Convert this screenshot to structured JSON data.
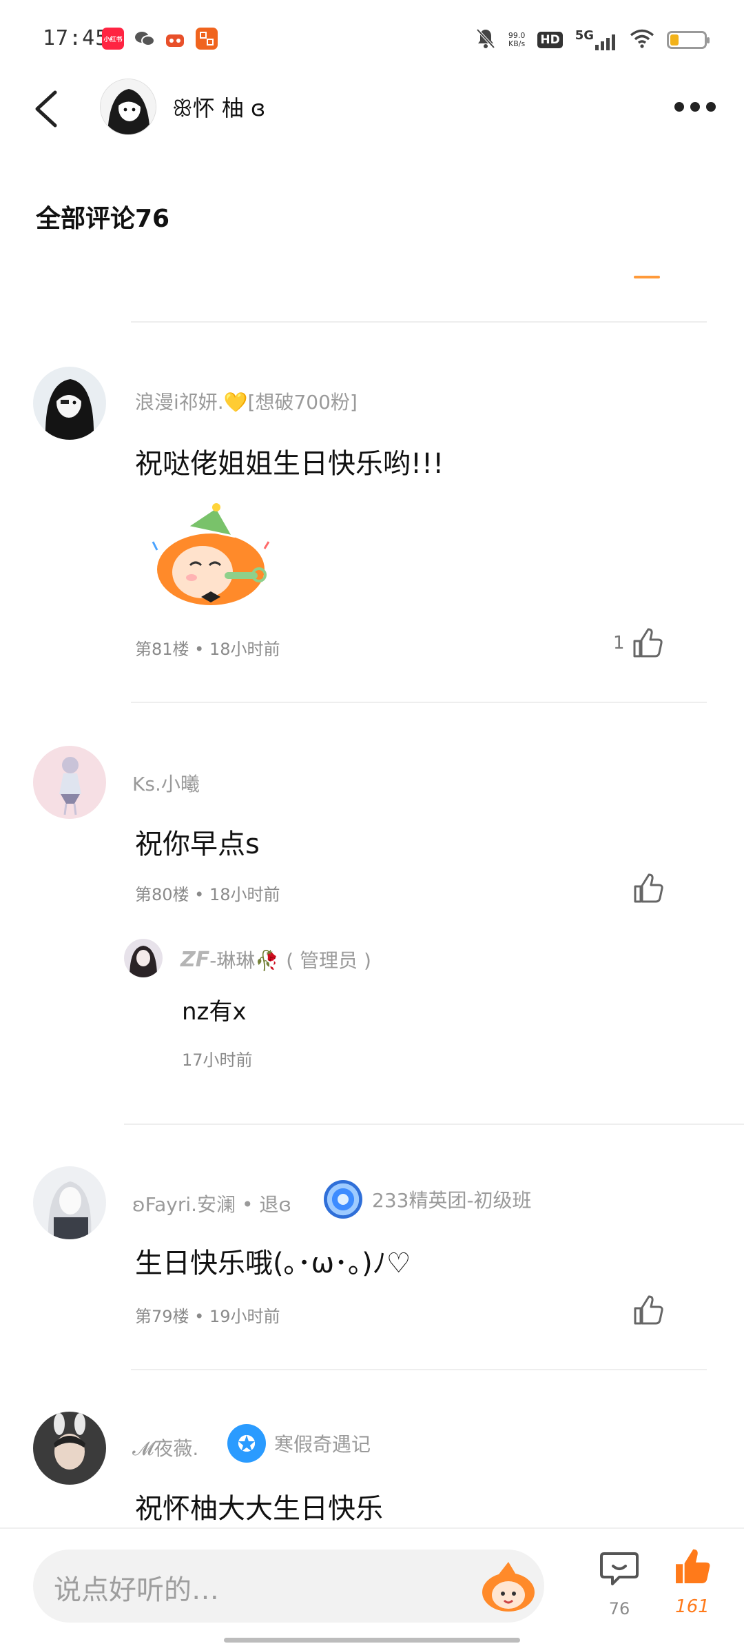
{
  "status_bar": {
    "time": "17:45",
    "app_icon_1": "小红书",
    "net_speed_value": "99.0",
    "net_speed_unit": "KB/s",
    "hd": "HD",
    "network": "5G"
  },
  "header": {
    "username": "ꕥ怀 柚 ɞ"
  },
  "section": {
    "title": "全部评论76"
  },
  "comments": [
    {
      "username": "浪漫i祁妍.💛[想破700粉]",
      "text": "祝哒佬姐姐生日快乐哟!!!",
      "meta": "第81楼 • 18小时前",
      "likes": "1"
    },
    {
      "username": "Ks.小曦",
      "text": "祝你早点s",
      "meta": "第80楼 • 18小时前",
      "likes": ""
    },
    {
      "username": "ʚFayri.安澜 • 退ɞ",
      "badge": "233精英团-初级班",
      "text": "生日快乐哦(｡･ω･｡)ﾉ♡",
      "meta": "第79楼 • 19小时前",
      "likes": ""
    },
    {
      "username": "𝓜夜薇.",
      "badge": "寒假奇遇记",
      "text": "祝怀柚大大生日快乐"
    }
  ],
  "reply": {
    "username_prefix": "ZF",
    "username": "-琳琳🥀",
    "role": "( 管理员 )",
    "text": "nz有x",
    "time": "17小时前"
  },
  "bottom_bar": {
    "placeholder": "说点好听的…",
    "comment_count": "76",
    "like_count": "161"
  },
  "colors": {
    "accent": "#ff7a1a",
    "muted_text": "#9a9a9a",
    "divider": "#eeeeee"
  }
}
